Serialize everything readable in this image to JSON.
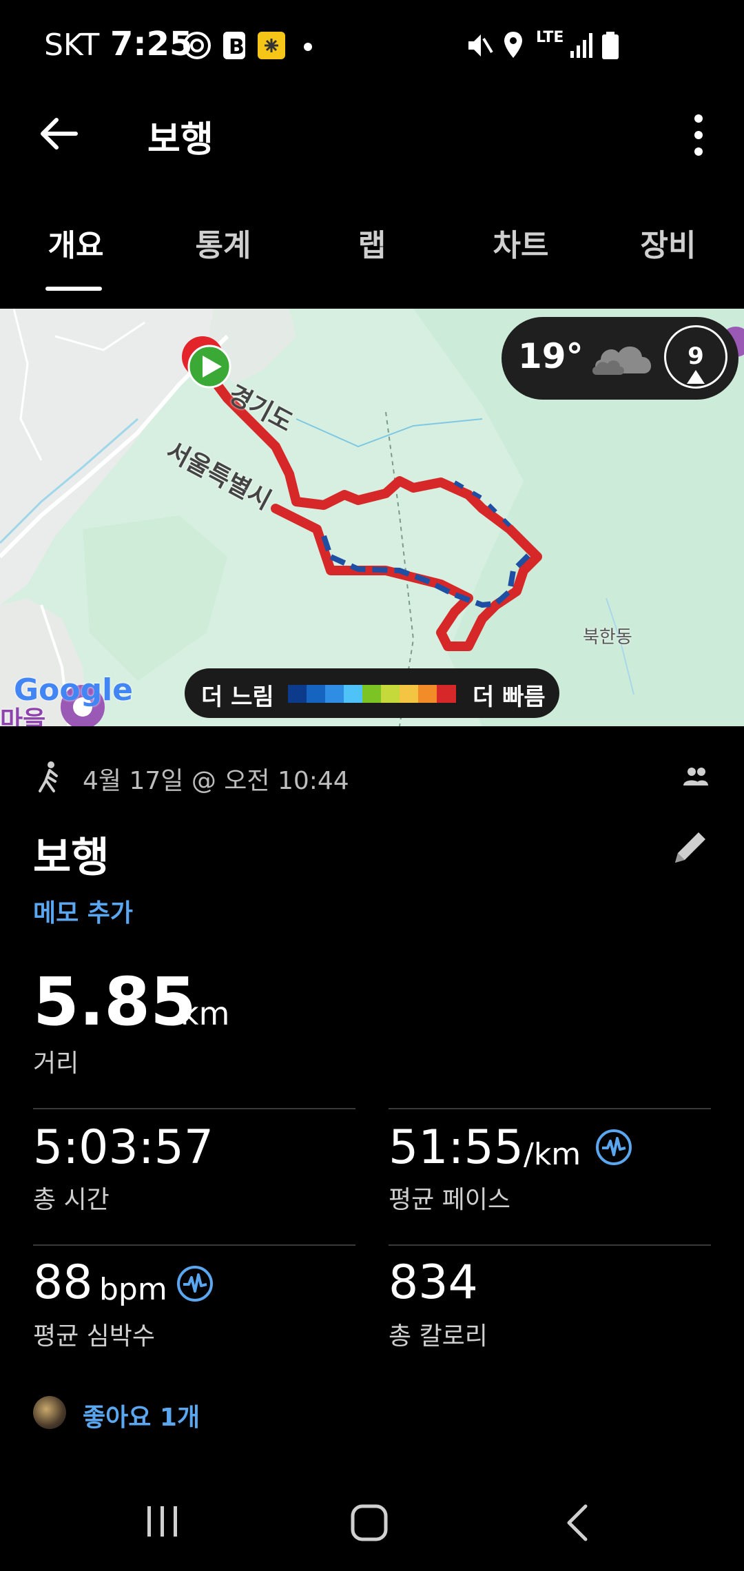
{
  "status_bar": {
    "carrier": "SKT",
    "time": "7:25",
    "network": "LTE"
  },
  "app_bar": {
    "title": "보행"
  },
  "tabs": [
    "개요",
    "통계",
    "랩",
    "차트",
    "장비"
  ],
  "map": {
    "labels": [
      "경기도",
      "서울특별시",
      "북한동"
    ],
    "weather": {
      "temperature": "19°",
      "wind": "9"
    },
    "legend": {
      "slow": "더 느림",
      "fast": "더 빠름"
    },
    "provider": "Google",
    "corner_label": "마을"
  },
  "activity": {
    "datetime": "4월 17일 @ 오전 10:44",
    "title": "보행",
    "memo_link": "메모 추가",
    "distance": {
      "value": "5.85",
      "unit": "km",
      "label": "거리"
    },
    "stats": [
      {
        "value": "5:03:57",
        "unit": "",
        "label": "총 시간"
      },
      {
        "value": "51:55",
        "unit": "/km",
        "label": "평균 페이스"
      },
      {
        "value": "88",
        "unit": "bpm",
        "label": "평균 심박수"
      },
      {
        "value": "834",
        "unit": "",
        "label": "총 칼로리"
      }
    ],
    "likes": "좋아요 1개"
  },
  "colors": {
    "accent": "#5aa7f0",
    "route": "#d62828",
    "start": "#3aa935"
  }
}
